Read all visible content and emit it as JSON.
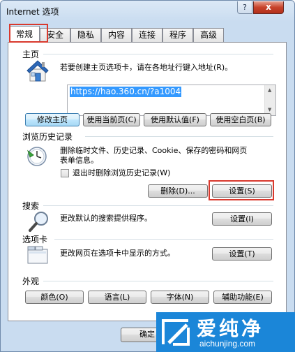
{
  "window": {
    "title": "Internet 选项",
    "help_label": "?",
    "close_label": "x",
    "accent_highlight": "#d9392d"
  },
  "tabs": [
    {
      "label": "常规",
      "active": true
    },
    {
      "label": "安全"
    },
    {
      "label": "隐私"
    },
    {
      "label": "内容"
    },
    {
      "label": "连接"
    },
    {
      "label": "程序"
    },
    {
      "label": "高级"
    }
  ],
  "homepage": {
    "title": "主页",
    "desc": "若要创建主页选项卡，请在各地址行键入地址(R)。",
    "url": "https://hao.360.cn/?a1004",
    "buttons": {
      "current": "修改主页",
      "use_current": "使用当前页(C)",
      "use_default": "使用默认值(F)",
      "use_blank": "使用空白页(B)"
    }
  },
  "history": {
    "title": "浏览历史记录",
    "desc_line1": "删除临时文件、历史记录、Cookie、保存的密码和网页",
    "desc_line2": "表单信息。",
    "checkbox_label": "退出时删除浏览历史记录(W)",
    "delete_button": "删除(D)...",
    "settings_button": "设置(S)"
  },
  "search": {
    "title": "搜索",
    "desc": "更改默认的搜索提供程序。",
    "settings_button": "设置(I)"
  },
  "tabs_section": {
    "title": "选项卡",
    "desc": "更改网页在选项卡中显示的方式。",
    "settings_button": "设置(T)"
  },
  "appearance": {
    "title": "外观",
    "buttons": {
      "colors": "颜色(O)",
      "languages": "语言(L)",
      "fonts": "字体(N)",
      "accessibility": "辅助功能(E)"
    }
  },
  "footer": {
    "ok": "确定"
  },
  "watermark": {
    "title": "爱纯净",
    "url": "aichunjing.com"
  }
}
